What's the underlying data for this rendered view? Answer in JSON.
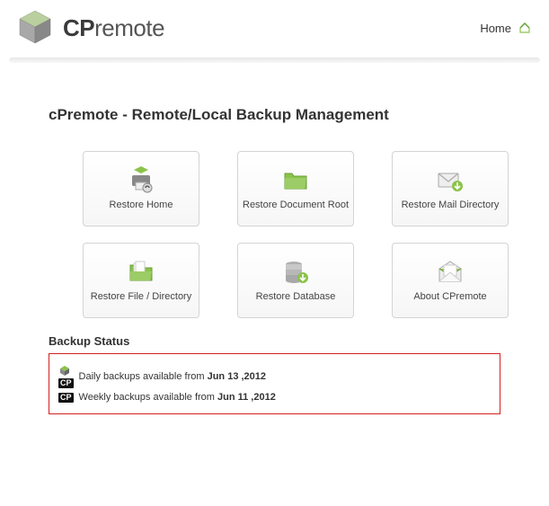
{
  "header": {
    "brand_prefix": "CP",
    "brand_suffix": "remote",
    "nav_home": "Home"
  },
  "page": {
    "title": "cPremote - Remote/Local Backup Management"
  },
  "tiles": [
    {
      "label": "Restore Home"
    },
    {
      "label": "Restore Document Root"
    },
    {
      "label": "Restore Mail Directory"
    },
    {
      "label": "Restore File / Directory"
    },
    {
      "label": "Restore Database"
    },
    {
      "label": "About CPremote"
    }
  ],
  "status": {
    "title": "Backup Status",
    "rows": [
      {
        "prefix": "Daily backups available from ",
        "date": "Jun 13 ,2012"
      },
      {
        "prefix": "Weekly backups available from ",
        "date": "Jun 11 ,2012"
      }
    ],
    "badge": "CP"
  }
}
